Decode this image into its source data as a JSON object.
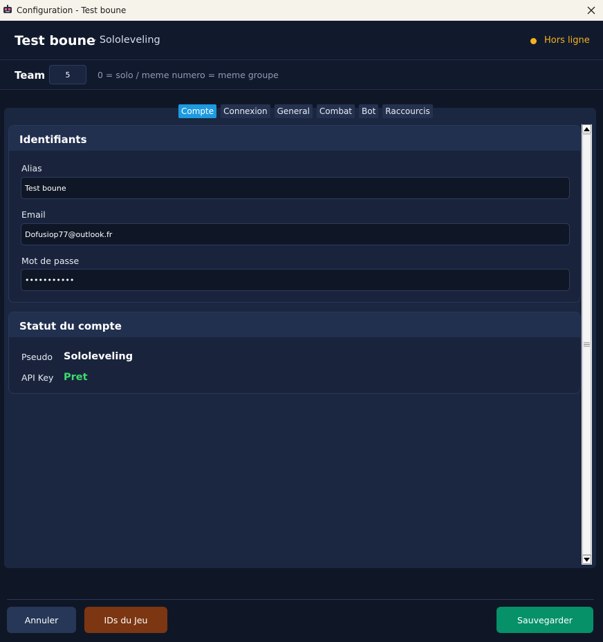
{
  "window": {
    "title": "Configuration - Test boune",
    "app_icon": "robot-icon",
    "close_icon": "close-icon"
  },
  "header": {
    "name": "Test boune",
    "subtitle": "-  Sololeveling",
    "status": "Hors ligne",
    "status_color": "#f6b21d"
  },
  "team": {
    "label": "Team",
    "value": "5",
    "hint": "0 = solo  /  meme numero = meme groupe"
  },
  "tabs": [
    {
      "label": "Compte",
      "active": true
    },
    {
      "label": "Connexion",
      "active": false
    },
    {
      "label": "General",
      "active": false
    },
    {
      "label": "Combat",
      "active": false
    },
    {
      "label": "Bot",
      "active": false
    },
    {
      "label": "Raccourcis",
      "active": false
    }
  ],
  "identifiants": {
    "title": "Identifiants",
    "alias_label": "Alias",
    "alias_value": "Test boune",
    "email_label": "Email",
    "email_value": "Dofusiop77@outlook.fr",
    "password_label": "Mot de passe",
    "password_value": "•••••••••••"
  },
  "statut": {
    "title": "Statut du compte",
    "pseudo_label": "Pseudo",
    "pseudo_value": "Sololeveling",
    "api_label": "API Key",
    "api_value": "Pret",
    "api_color": "#3ddc6e"
  },
  "footer": {
    "cancel_label": "Annuler",
    "ids_label": "IDs du Jeu",
    "save_label": "Sauvegarder"
  },
  "colors": {
    "accent": "#1d9ae0",
    "save": "#069169",
    "ids": "#7c3611"
  }
}
